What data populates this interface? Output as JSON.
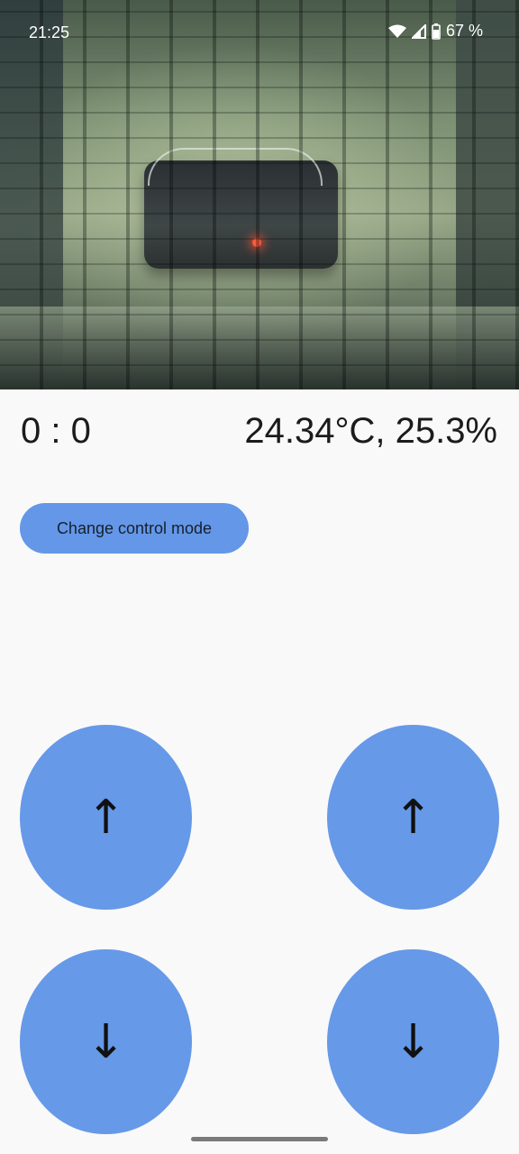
{
  "status_bar": {
    "time": "21:25",
    "battery_percent": "67 %",
    "icons": [
      "wifi-icon",
      "cell-signal-icon",
      "battery-icon"
    ]
  },
  "camera": {
    "icon": "camera-feed"
  },
  "readout": {
    "counter": "0 : 0",
    "sensor": "24.34°C, 25.3%"
  },
  "controls": {
    "change_mode_label": "Change control mode",
    "left_up": "↑",
    "left_down": "↓",
    "right_up": "↑",
    "right_down": "↓"
  },
  "colors": {
    "accent": "#6699e8",
    "background": "#f9f9f9"
  }
}
